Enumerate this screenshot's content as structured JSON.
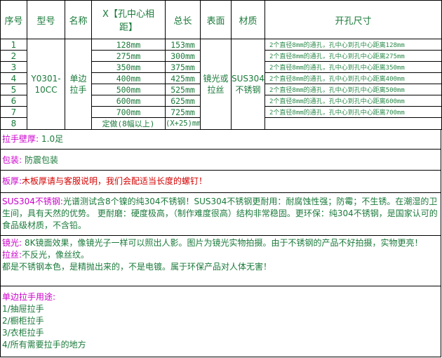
{
  "table": {
    "headers": [
      "序号",
      "型号",
      "名称",
      "X【孔中心相距】",
      "总长",
      "表面",
      "材质",
      "开孔尺寸"
    ],
    "model": "Y0301-10CC",
    "name": "单边拉手",
    "surface": "镜光或拉丝",
    "material": "SUS304不锈钢",
    "rows": [
      {
        "idx": "1",
        "x": "128mm",
        "total": "153mm",
        "hole": "2个直径8mm的通孔，孔中心到孔中心距离128mm"
      },
      {
        "idx": "2",
        "x": "275mm",
        "total": "300mm",
        "hole": "2个直径8mm的通孔，孔中心到孔中心距离275mm"
      },
      {
        "idx": "3",
        "x": "350mm",
        "total": "375mm",
        "hole": "2个直径8mm的通孔，孔中心到孔中心距离350mm"
      },
      {
        "idx": "4",
        "x": "400mm",
        "total": "425mm",
        "hole": "2个直径8mm的通孔，孔中心到孔中心距离400mm"
      },
      {
        "idx": "5",
        "x": "500mm",
        "total": "525mm",
        "hole": "2个直径8mm的通孔，孔中心到孔中心距离500mm"
      },
      {
        "idx": "6",
        "x": "600mm",
        "total": "625mm",
        "hole": "2个直径8mm的通孔，孔中心到孔中心距离600mm"
      },
      {
        "idx": "7",
        "x": "700mm",
        "total": "725mm",
        "hole": "2个直径8mm的通孔，孔中心到孔中心距离700mm"
      },
      {
        "idx": "8",
        "x": "定做(8幅以上)",
        "total": "(X+25)mm",
        "hole": ""
      }
    ]
  },
  "thickness": {
    "label": "拉手壁厚:",
    "value": "1.0足"
  },
  "packing": {
    "label": "包装:",
    "value": "防震包装"
  },
  "board": {
    "label": "板厚:",
    "value_red": "木板厚请与客服说明，我们会配适当长度的螺钉！"
  },
  "steel": {
    "label": "SUS304不锈钢:",
    "text": "光谱测试含8个镍的纯304不锈钢！SUS304不锈钢更耐用：耐腐蚀性强；防霉；不生锈。在潮湿的卫生间，具有天然的优势。 更耐磨：硬度极高，（制作难度很高）结构非常稳固。更环保：纯304不锈钢，是国家认可的食品级材质，不含铅。"
  },
  "finish": {
    "mirror_label": "镜光:",
    "mirror_text": "8K镜面效果，像镜光子一样可以照出人影。图片为镜光实物拍摄。由于不锈钢的产品不好拍摄，实物更亮！",
    "brushed_label": "拉丝:",
    "brushed_text": "不反光，像丝纹。",
    "note": "都是不锈钢本色，是精抛出来的，不是电镀。属于环保产品对人体无害！"
  },
  "usage": {
    "title": "单边拉手用途:",
    "items": [
      "1/抽屉拉手",
      "2/橱柜拉手",
      "3/衣柜拉手",
      "4/所有需要拉手的地方"
    ]
  }
}
